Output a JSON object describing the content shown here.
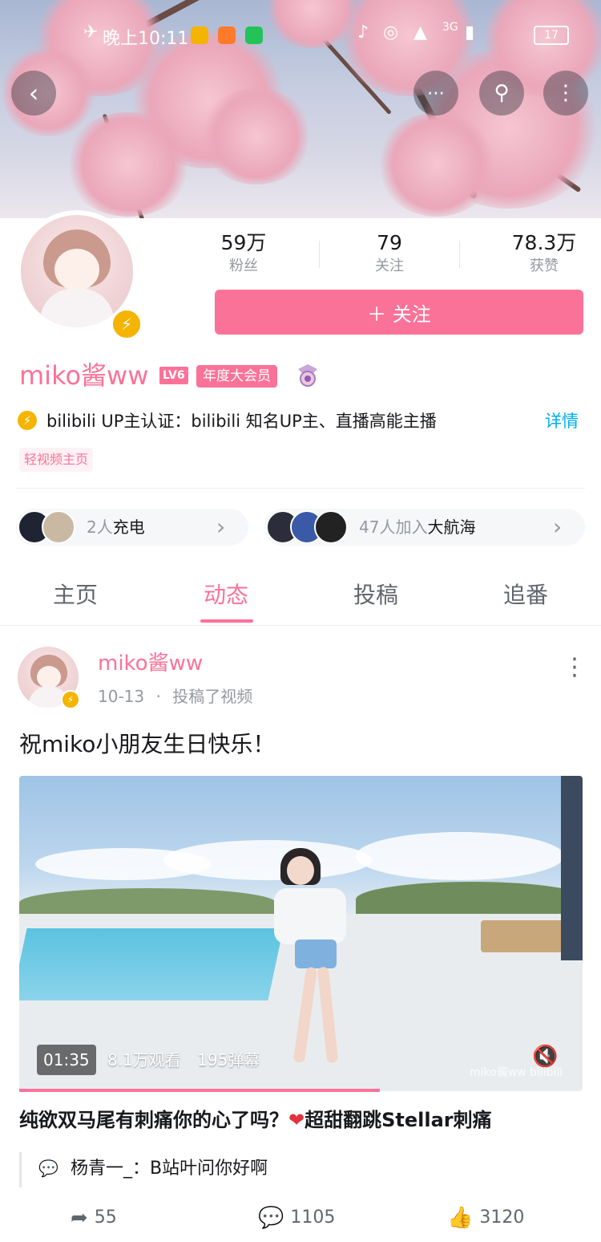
{
  "status_bar": {
    "time": "晚上10:11",
    "network": "3G",
    "battery": "17"
  },
  "banner": {
    "back_icon": "back-arrow-icon",
    "actions": [
      "chat-icon",
      "search-icon",
      "more-icon"
    ]
  },
  "profile": {
    "stats": [
      {
        "value": "59万",
        "label": "粉丝"
      },
      {
        "value": "79",
        "label": "关注"
      },
      {
        "value": "78.3万",
        "label": "获赞"
      }
    ],
    "follow_label": "＋ 关注",
    "username": "miko酱ww",
    "level": "LV6",
    "vip_badge": "年度大会员",
    "certification": "bilibili UP主认证：bilibili 知名UP主、直播高能主播",
    "detail_link": "详情",
    "tag": "轻视频主页",
    "charge": {
      "count": "2人",
      "text": "充电"
    },
    "guard": {
      "count": "47人加入",
      "text": "大航海"
    }
  },
  "tabs": [
    {
      "label": "主页",
      "active": false
    },
    {
      "label": "动态",
      "active": true
    },
    {
      "label": "投稿",
      "active": false
    },
    {
      "label": "追番",
      "active": false
    }
  ],
  "post": {
    "author": "miko酱ww",
    "date": "10-13",
    "action": "投稿了视频",
    "text": "祝miko小朋友生日快乐！",
    "video": {
      "duration": "01:35",
      "views": "8.1万观看",
      "danmaku": "195弹幕",
      "watermark": "miko酱ww bilibili",
      "progress": 0.64
    },
    "video_title_a": "纯欲双马尾有刺痛你的心了吗？",
    "video_title_b": "超甜翻跳Stellar刺痛",
    "comment_user": "杨青一_",
    "comment_text": "：B站叶问你好啊",
    "shares": "55",
    "comments": "1105",
    "likes": "3120"
  },
  "colors": {
    "accent": "#fb7299",
    "link": "#00aeec",
    "verified": "#f5b400"
  }
}
